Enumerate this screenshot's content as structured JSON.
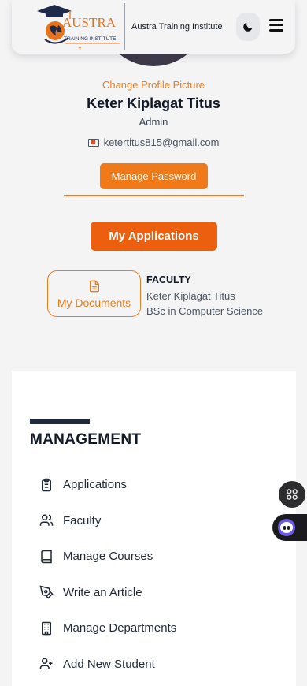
{
  "header": {
    "logo_text": "AUSTRA",
    "logo_subtext": "TRAINING INSTITUTE",
    "institution_name": "Austra Training Institute",
    "theme_icon": "moon-icon",
    "menu_icon": "hamburger-menu-icon"
  },
  "profile": {
    "change_picture_label": "Change Profile Picture",
    "name": "Keter Kiplagat Titus",
    "role": "Admin",
    "email": "ketertitus815@gmail.com",
    "manage_password_label": "Manage Password"
  },
  "actions": {
    "my_applications_label": "My Applications",
    "my_documents_label": "My Documents"
  },
  "faculty": {
    "title": "FACULTY",
    "name": "Keter Kiplagat Titus",
    "degree": "BSc in Computer Science"
  },
  "management": {
    "title": "MANAGEMENT",
    "items": [
      {
        "label": "Applications",
        "icon": "clipboard-list-icon"
      },
      {
        "label": "Faculty",
        "icon": "users-icon"
      },
      {
        "label": "Manage Courses",
        "icon": "book-icon"
      },
      {
        "label": "Write an Article",
        "icon": "pen-tool-icon"
      },
      {
        "label": "Manage Departments",
        "icon": "building-icon"
      },
      {
        "label": "Add New Student",
        "icon": "user-plus-icon"
      }
    ]
  },
  "colors": {
    "accent": "#ea7d1f",
    "button_orange": "#f07a1a",
    "applications_orange": "#ec5f0f",
    "navy": "#1e2a3b"
  }
}
